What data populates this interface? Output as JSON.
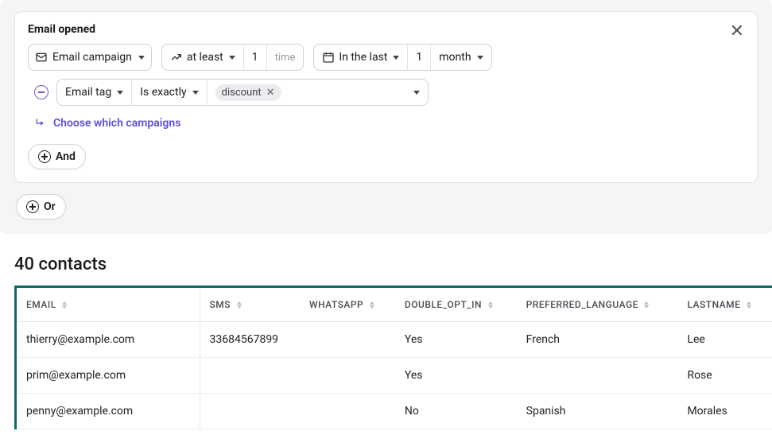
{
  "filter": {
    "title": "Email opened",
    "campaign_dropdown": "Email campaign",
    "comparator": "at least",
    "count": "1",
    "count_unit": "time",
    "time_range_label": "In the last",
    "time_value": "1",
    "time_unit": "month",
    "sub": {
      "field": "Email tag",
      "operator": "Is exactly",
      "tag_value": "discount"
    },
    "choose_link": "Choose which campaigns",
    "and_label": "And",
    "or_label": "Or"
  },
  "results": {
    "count": "40",
    "noun": "contacts",
    "columns": [
      "EMAIL",
      "SMS",
      "WHATSAPP",
      "DOUBLE_OPT_IN",
      "PREFERRED_LANGUAGE",
      "LASTNAME"
    ],
    "rows": [
      {
        "email": "thierry@example.com",
        "sms": "33684567899",
        "whatsapp": "",
        "double_opt_in": "Yes",
        "preferred_language": "French",
        "lastname": "Lee"
      },
      {
        "email": "prim@example.com",
        "sms": "",
        "whatsapp": "",
        "double_opt_in": "Yes",
        "preferred_language": "",
        "lastname": "Rose"
      },
      {
        "email": "penny@example.com",
        "sms": "",
        "whatsapp": "",
        "double_opt_in": "No",
        "preferred_language": "Spanish",
        "lastname": "Morales"
      }
    ]
  }
}
